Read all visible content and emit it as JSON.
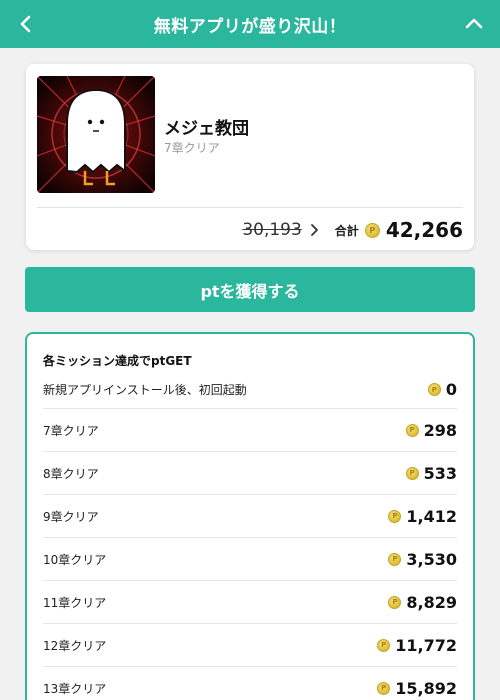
{
  "header": {
    "title": "無料アプリが盛り沢山！",
    "back_icon": "chevron-left-icon",
    "collapse_icon": "chevron-up-icon"
  },
  "app": {
    "name": "メジェ教団",
    "subtitle": "7章クリア",
    "old_points": "30,193",
    "total_label": "合計",
    "total_points": "42,266"
  },
  "cta": {
    "label": "ptを獲得する"
  },
  "missions": {
    "title": "各ミッション達成でptGET",
    "items": [
      {
        "label": "新規アプリインストール後、初回起動",
        "points": "0"
      },
      {
        "label": "7章クリア",
        "points": "298"
      },
      {
        "label": "8章クリア",
        "points": "533"
      },
      {
        "label": "9章クリア",
        "points": "1,412"
      },
      {
        "label": "10章クリア",
        "points": "3,530"
      },
      {
        "label": "11章クリア",
        "points": "8,829"
      },
      {
        "label": "12章クリア",
        "points": "11,772"
      },
      {
        "label": "13章クリア",
        "points": "15,892"
      }
    ]
  },
  "colors": {
    "brand": "#2bb79e",
    "coin": "#e1c23a",
    "background": "#f1f1f1"
  }
}
